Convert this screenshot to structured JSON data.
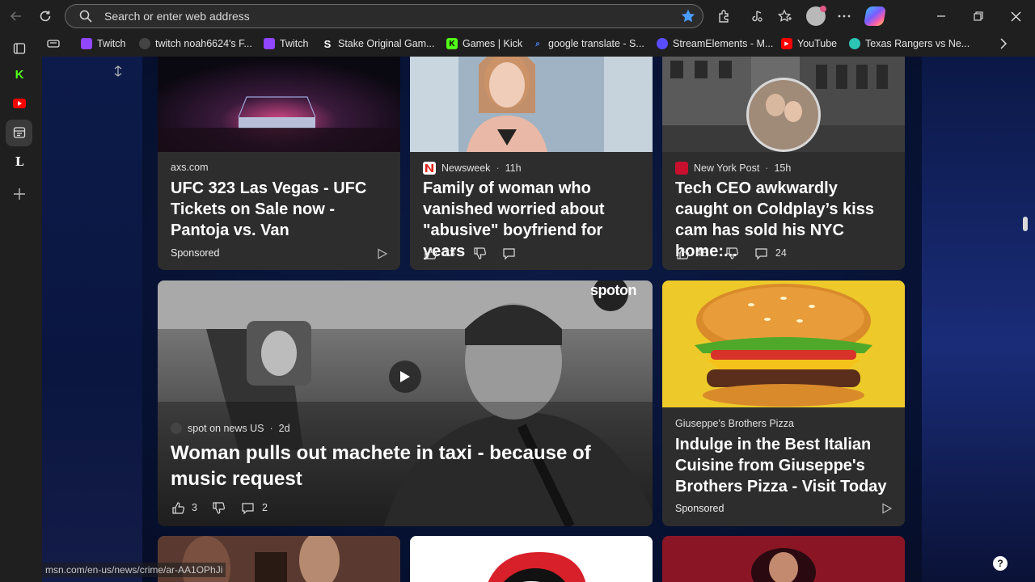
{
  "address_bar": {
    "placeholder": "Search or enter web address"
  },
  "favorites": [
    {
      "label": "Twitch",
      "color": "#9146ff"
    },
    {
      "label": "twitch noah6624's F...",
      "color": "#444444"
    },
    {
      "label": "Twitch",
      "color": "#9146ff"
    },
    {
      "label": "Stake Original Gam...",
      "color": "#ffffff"
    },
    {
      "label": "Games | Kick",
      "color": "#53fc18"
    },
    {
      "label": "google translate - S...",
      "color": "#4a8cff"
    },
    {
      "label": "StreamElements - M...",
      "color": "#5a4cff"
    },
    {
      "label": "YouTube",
      "color": "#ff0000"
    },
    {
      "label": "Texas Rangers vs Ne...",
      "color": "#2cc4b4"
    }
  ],
  "cards": {
    "ufc": {
      "source": "axs.com",
      "title": "UFC 323 Las Vegas - UFC Tickets on Sale now - Pantoja vs. Van",
      "sponsored": "Sponsored"
    },
    "newsweek": {
      "source": "Newsweek",
      "age": "11h",
      "title": "Family of woman who vanished worried about \"abusive\" boyfriend for years",
      "likes": "23"
    },
    "nypost": {
      "source": "New York Post",
      "age": "15h",
      "title": "Tech CEO awkwardly caught on Coldplay’s kiss cam has sold his NYC home:...",
      "likes": "48",
      "comments": "24"
    },
    "spoton": {
      "source": "spot on news US",
      "age": "2d",
      "title": "Woman pulls out machete in taxi - because of music request",
      "likes": "3",
      "comments": "2",
      "watermark": "spoton"
    },
    "pizza": {
      "source": "Giuseppe's Brothers Pizza",
      "title": "Indulge in the Best Italian Cuisine from Giuseppe's Brothers Pizza - Visit Today",
      "sponsored": "Sponsored"
    }
  },
  "status_url": "msn.com/en-us/news/crime/ar-AA1OPhJi",
  "colors": {
    "card_bg": "#2d2d2d",
    "browser_bg": "#1f1f1f",
    "page_bg": "#071234"
  }
}
